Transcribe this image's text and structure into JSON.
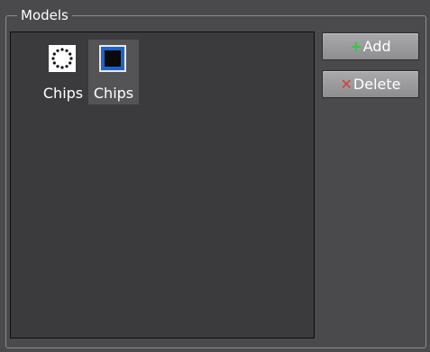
{
  "group": {
    "title": "Models"
  },
  "models": [
    {
      "label": "Chips",
      "icon": "dotted-circle-chip-icon"
    },
    {
      "label": "Chips",
      "icon": "black-square-chip-icon"
    }
  ],
  "buttons": {
    "add": {
      "label": "Add",
      "icon": "plus-icon",
      "icon_color": "#2ecc40"
    },
    "delete": {
      "label": "Delete",
      "icon": "x-icon",
      "icon_color": "#e03a2e"
    }
  },
  "selected_index": 1
}
